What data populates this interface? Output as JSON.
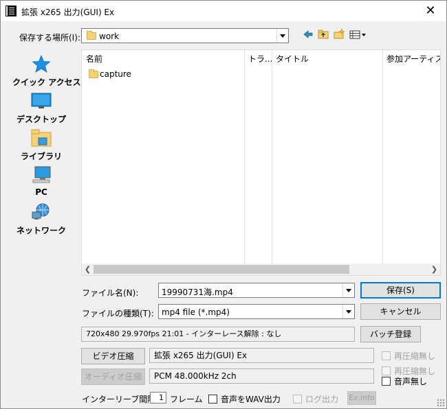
{
  "window": {
    "title": "拡張 x265 出力(GUI) Ex",
    "close_glyph": "✕"
  },
  "location": {
    "label": "保存する場所(I):",
    "value": "work"
  },
  "places": [
    {
      "label": "クイック アクセス",
      "icon": "quick-access-star-icon"
    },
    {
      "label": "デスクトップ",
      "icon": "desktop-icon"
    },
    {
      "label": "ライブラリ",
      "icon": "library-icon"
    },
    {
      "label": "PC",
      "icon": "pc-icon"
    },
    {
      "label": "ネットワーク",
      "icon": "network-icon"
    }
  ],
  "columns": [
    "名前",
    "トラ...",
    "タイトル",
    "参加アーティスト"
  ],
  "files": [
    {
      "name": "capture"
    }
  ],
  "filename": {
    "label": "ファイル名(N):",
    "value": "19990731海.mp4"
  },
  "filetype": {
    "label": "ファイルの種類(T):",
    "value": "mp4 file (*.mp4)"
  },
  "buttons": {
    "save": "保存(S)",
    "cancel": "キャンセル",
    "batch": "バッチ登録",
    "video": "ビデオ圧縮",
    "audio": "オーディオ圧縮",
    "exinfo": "Ex.info"
  },
  "info": {
    "video_summary": "720x480  29.970fps  21:01  -  インターレース解除 : なし",
    "video_codec": "拡張 x265 出力(GUI) Ex",
    "audio_codec": "PCM 48.000kHz 2ch"
  },
  "checks": {
    "recompress_video": "再圧縮無し",
    "recompress_audio": "再圧縮無し",
    "no_audio": "音声無し",
    "wav_out": "音声をWAV出力",
    "log_out": "ログ出力"
  },
  "interleave": {
    "label": "インターリーブ間隔 :",
    "value": "1",
    "unit": "フレーム"
  },
  "colors": {
    "accent": "#0078d7",
    "folder": "#f6d277"
  }
}
